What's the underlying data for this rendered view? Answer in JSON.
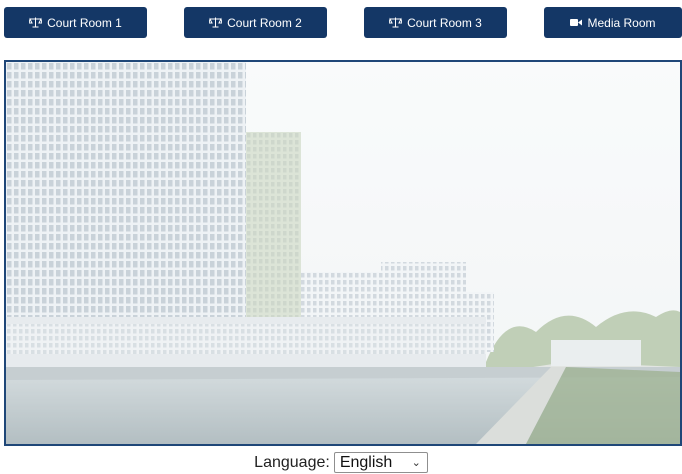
{
  "nav": {
    "court_room_1": "Court Room 1",
    "court_room_2": "Court Room 2",
    "court_room_3": "Court Room 3",
    "media_room": "Media Room",
    "court_icon": "scales-icon",
    "media_icon": "video-camera-icon"
  },
  "language": {
    "label": "Language:",
    "selected": "English"
  },
  "colors": {
    "button_bg": "#143766",
    "frame_border": "#1f4778"
  }
}
